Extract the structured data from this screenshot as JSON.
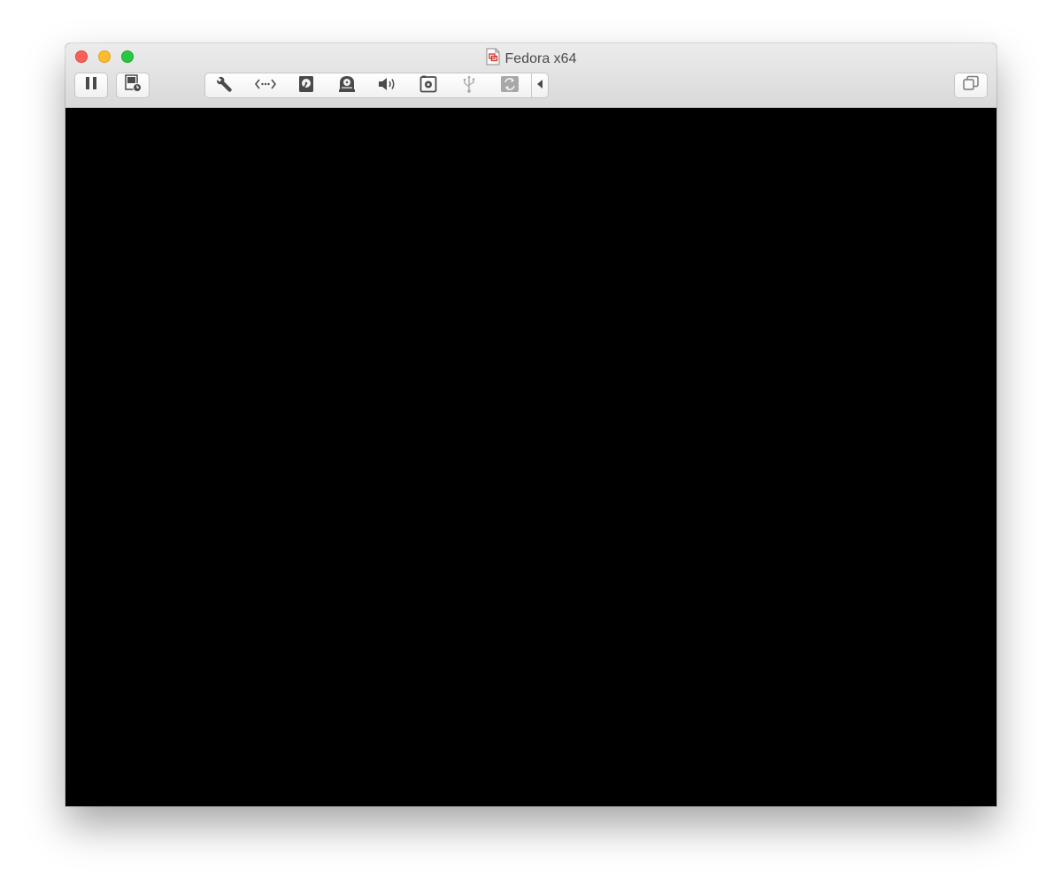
{
  "window": {
    "title": "Fedora x64"
  },
  "icons": {
    "document": "vm-document-icon",
    "pause": "pause-icon",
    "snapshot": "snapshot-icon",
    "settings": "wrench-icon",
    "network": "network-icon",
    "hard_disk": "hard-disk-icon",
    "cd_dvd": "cd-dvd-icon",
    "sound": "speaker-icon",
    "camera": "camera-icon",
    "usb": "usb-icon",
    "sharing": "sharing-icon",
    "collapse": "triangle-left-icon",
    "restore": "window-restore-icon"
  },
  "colors": {
    "close": "#fe5f57",
    "minimize": "#febc2e",
    "maximize": "#28c840",
    "screen": "#000000",
    "icon": "#4a4a4a",
    "icon_disabled": "#a8a8a8"
  }
}
